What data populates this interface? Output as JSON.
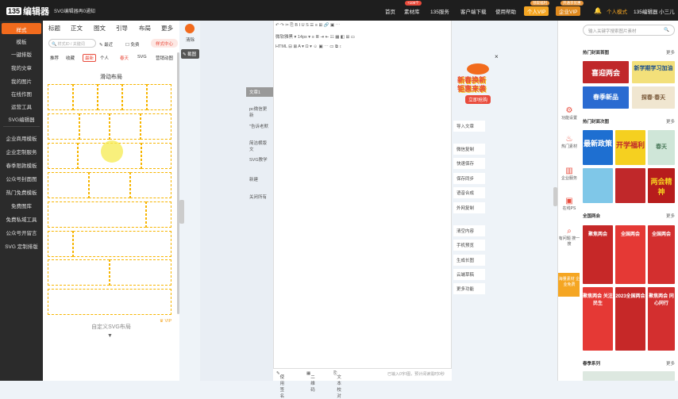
{
  "header": {
    "logo_mark": "135",
    "logo_text": "编辑器",
    "notice": "SVG编辑器再0通知",
    "nav": [
      "首页",
      "素材库",
      "135服务",
      "客户端下载",
      "使用帮助"
    ],
    "badge_new": "+108个",
    "badge_vip": "领取福利",
    "badge_vip2": "开通享优惠",
    "vip_personal": "个人VIP",
    "vip_enterprise": "企业VIP",
    "bell": "通知",
    "mode": "个人模式",
    "user": "135编辑器 小三儿"
  },
  "sidebar": {
    "items": [
      "样式",
      "模板",
      "一键排版",
      "我的文章",
      "我的图片",
      "在线作图",
      "运营工具",
      "SVG编辑器",
      "企业商用模板",
      "企业定制服务",
      "春季限款模板",
      "公众号封面图",
      "热门免费模板",
      "免费图库",
      "免费私域工具",
      "公众号开留言",
      "SVG 定制排版"
    ]
  },
  "panel": {
    "tabs": [
      "标题",
      "正文",
      "图文",
      "引导",
      "布局",
      "更多"
    ],
    "search_placeholder": "样式ID / 关键词",
    "recent": "最近",
    "free": "免费",
    "style_center": "样式中心",
    "cats": [
      "推荐",
      "收藏",
      "最新",
      "个人",
      "春天",
      "SVG",
      "营销动图"
    ],
    "title": "滑动布局",
    "custom": "自定义SVG布局",
    "vip": "VIP",
    "arrow": "▼"
  },
  "editor_tools": {
    "clear": "清除",
    "snap": "截图",
    "font_family": "微软雅黑",
    "font_size": "14px",
    "html": "HTML"
  },
  "side_list": [
    "文章1",
    "pc微信更新",
    "\"告诉老默",
    "简洁横版文",
    "SVG教学",
    "新建",
    "关闭所有"
  ],
  "right_tools": [
    "导入文章",
    "微信复制",
    "快速保存",
    "保存同步",
    "语音合成",
    "外网复制",
    "清空内容",
    "手机预览",
    "生成长图",
    "云端草稿",
    "更多功能"
  ],
  "right_bar": [
    "功能设置",
    "热门素材",
    "企业服务",
    "在线PS",
    "有问题 搜一搜",
    "海量素材 企业免费"
  ],
  "promo": {
    "line1": "新春换新",
    "line2": "钜惠来袭",
    "btn": "立即抢购",
    "close": "×"
  },
  "gallery": {
    "search_placeholder": "输入关键字搜索图片素材",
    "sec1": "热门封面首图",
    "sec2": "热门封面次图",
    "sec3": "全国两会",
    "sec4": "春季系列",
    "more": "更多",
    "thumbs1": [
      "喜迎两会",
      "新学期学习加油",
      "春季新品",
      "探春·春天"
    ],
    "thumbs2": [
      "最新政策",
      "开学福利",
      "春天",
      "两会精神"
    ],
    "thumbs3": [
      "聚焦两会",
      "全国两会",
      "全国两会",
      "聚焦两会 关注民生",
      "2023全国两会",
      "聚焦两会 同心同行"
    ]
  },
  "footer": {
    "sign": "使用签名",
    "qr": "二维码",
    "check": "文本校对",
    "count": "已输入0字/图，预计阅读需时0秒"
  }
}
